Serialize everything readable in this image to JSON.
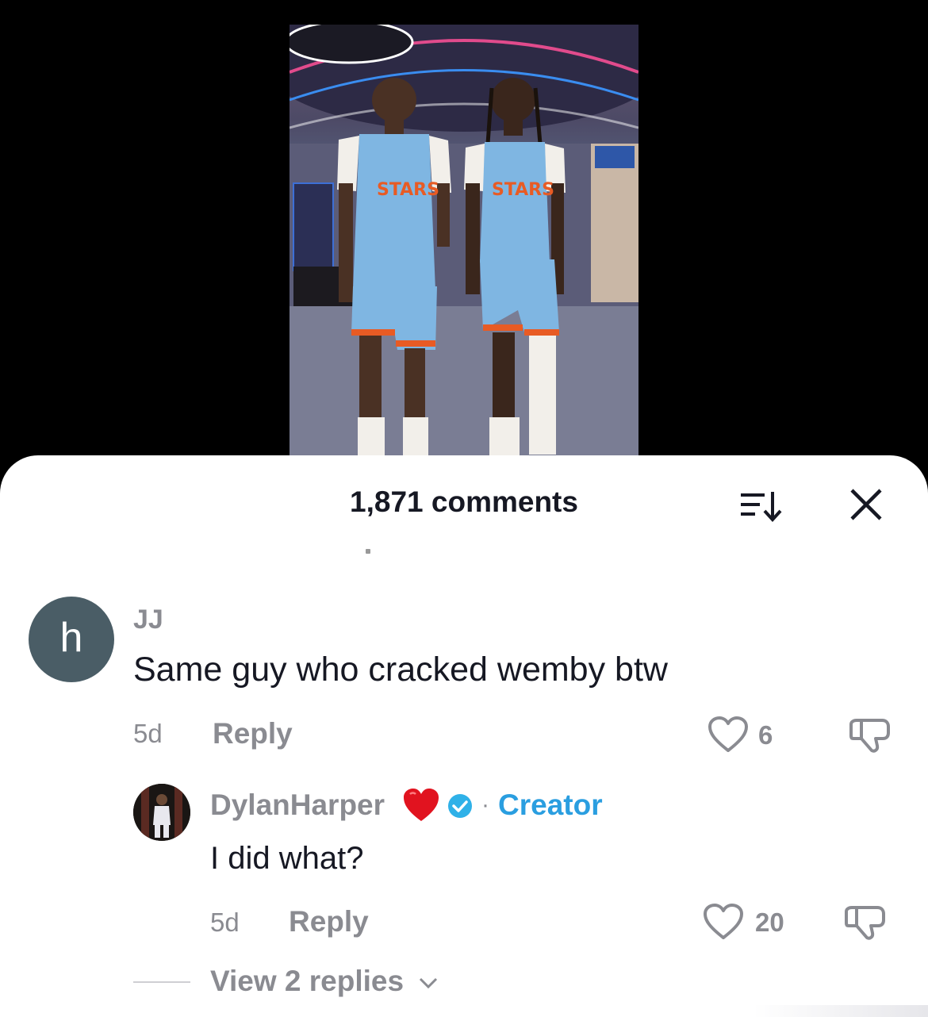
{
  "video": {},
  "header": {
    "comments_count": "1,871 comments",
    "sort_icon": "sort-down-icon",
    "close_icon": "close-icon"
  },
  "comment": {
    "avatar_letter": "h",
    "username": "JJ",
    "text": "Same guy who cracked wemby btw",
    "age": "5d",
    "reply_label": "Reply",
    "likes": "6"
  },
  "reply": {
    "username": "DylanHarper",
    "badge_icon": "verified-check-icon",
    "creator_label": "Creator",
    "separator": "·",
    "text": "I did what?",
    "age": "5d",
    "reply_label": "Reply",
    "likes": "20"
  },
  "thread": {
    "view_replies": "View 2 replies"
  },
  "colors": {
    "primary_text": "#161823",
    "secondary_text": "#8a8b91",
    "creator": "#2a9ee0",
    "avatar_bg": "#4a5d66"
  }
}
